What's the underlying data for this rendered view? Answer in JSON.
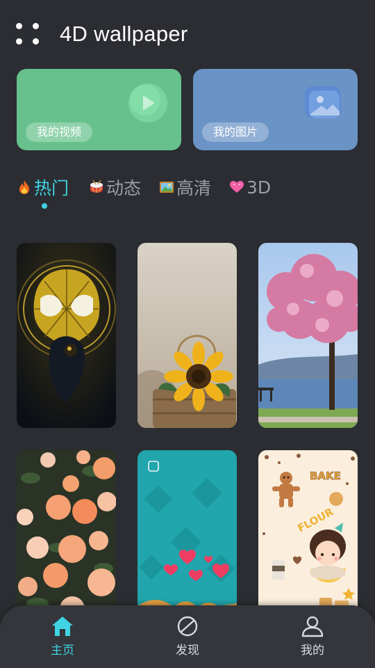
{
  "app": {
    "title": "4D wallpaper"
  },
  "cards": {
    "video_label": "我的视频",
    "photo_label": "我的图片"
  },
  "tabs": [
    {
      "label": "热门",
      "icon": "fire-icon",
      "active": true
    },
    {
      "label": "动态",
      "icon": "drum-icon",
      "active": false
    },
    {
      "label": "高清",
      "icon": "picture-icon",
      "active": false
    },
    {
      "label": "3D",
      "icon": "heart-icon",
      "active": false
    }
  ],
  "wallpapers": [
    {
      "subject": "spider-hero-mask"
    },
    {
      "subject": "sunflower-basket"
    },
    {
      "subject": "blossom-tree-lake"
    },
    {
      "subject": "orange-roses"
    },
    {
      "subject": "teal-hearts-lion"
    },
    {
      "subject": "bake-girl-cartoon"
    }
  ],
  "bottom_nav": [
    {
      "label": "主页",
      "icon": "home-icon",
      "active": true
    },
    {
      "label": "发现",
      "icon": "compass-icon",
      "active": false
    },
    {
      "label": "我的",
      "icon": "person-icon",
      "active": false
    }
  ],
  "colors": {
    "background": "#2b2d32",
    "accent": "#3fd3e3",
    "video_card": "#66c18c",
    "photo_card": "#6a93c6"
  }
}
